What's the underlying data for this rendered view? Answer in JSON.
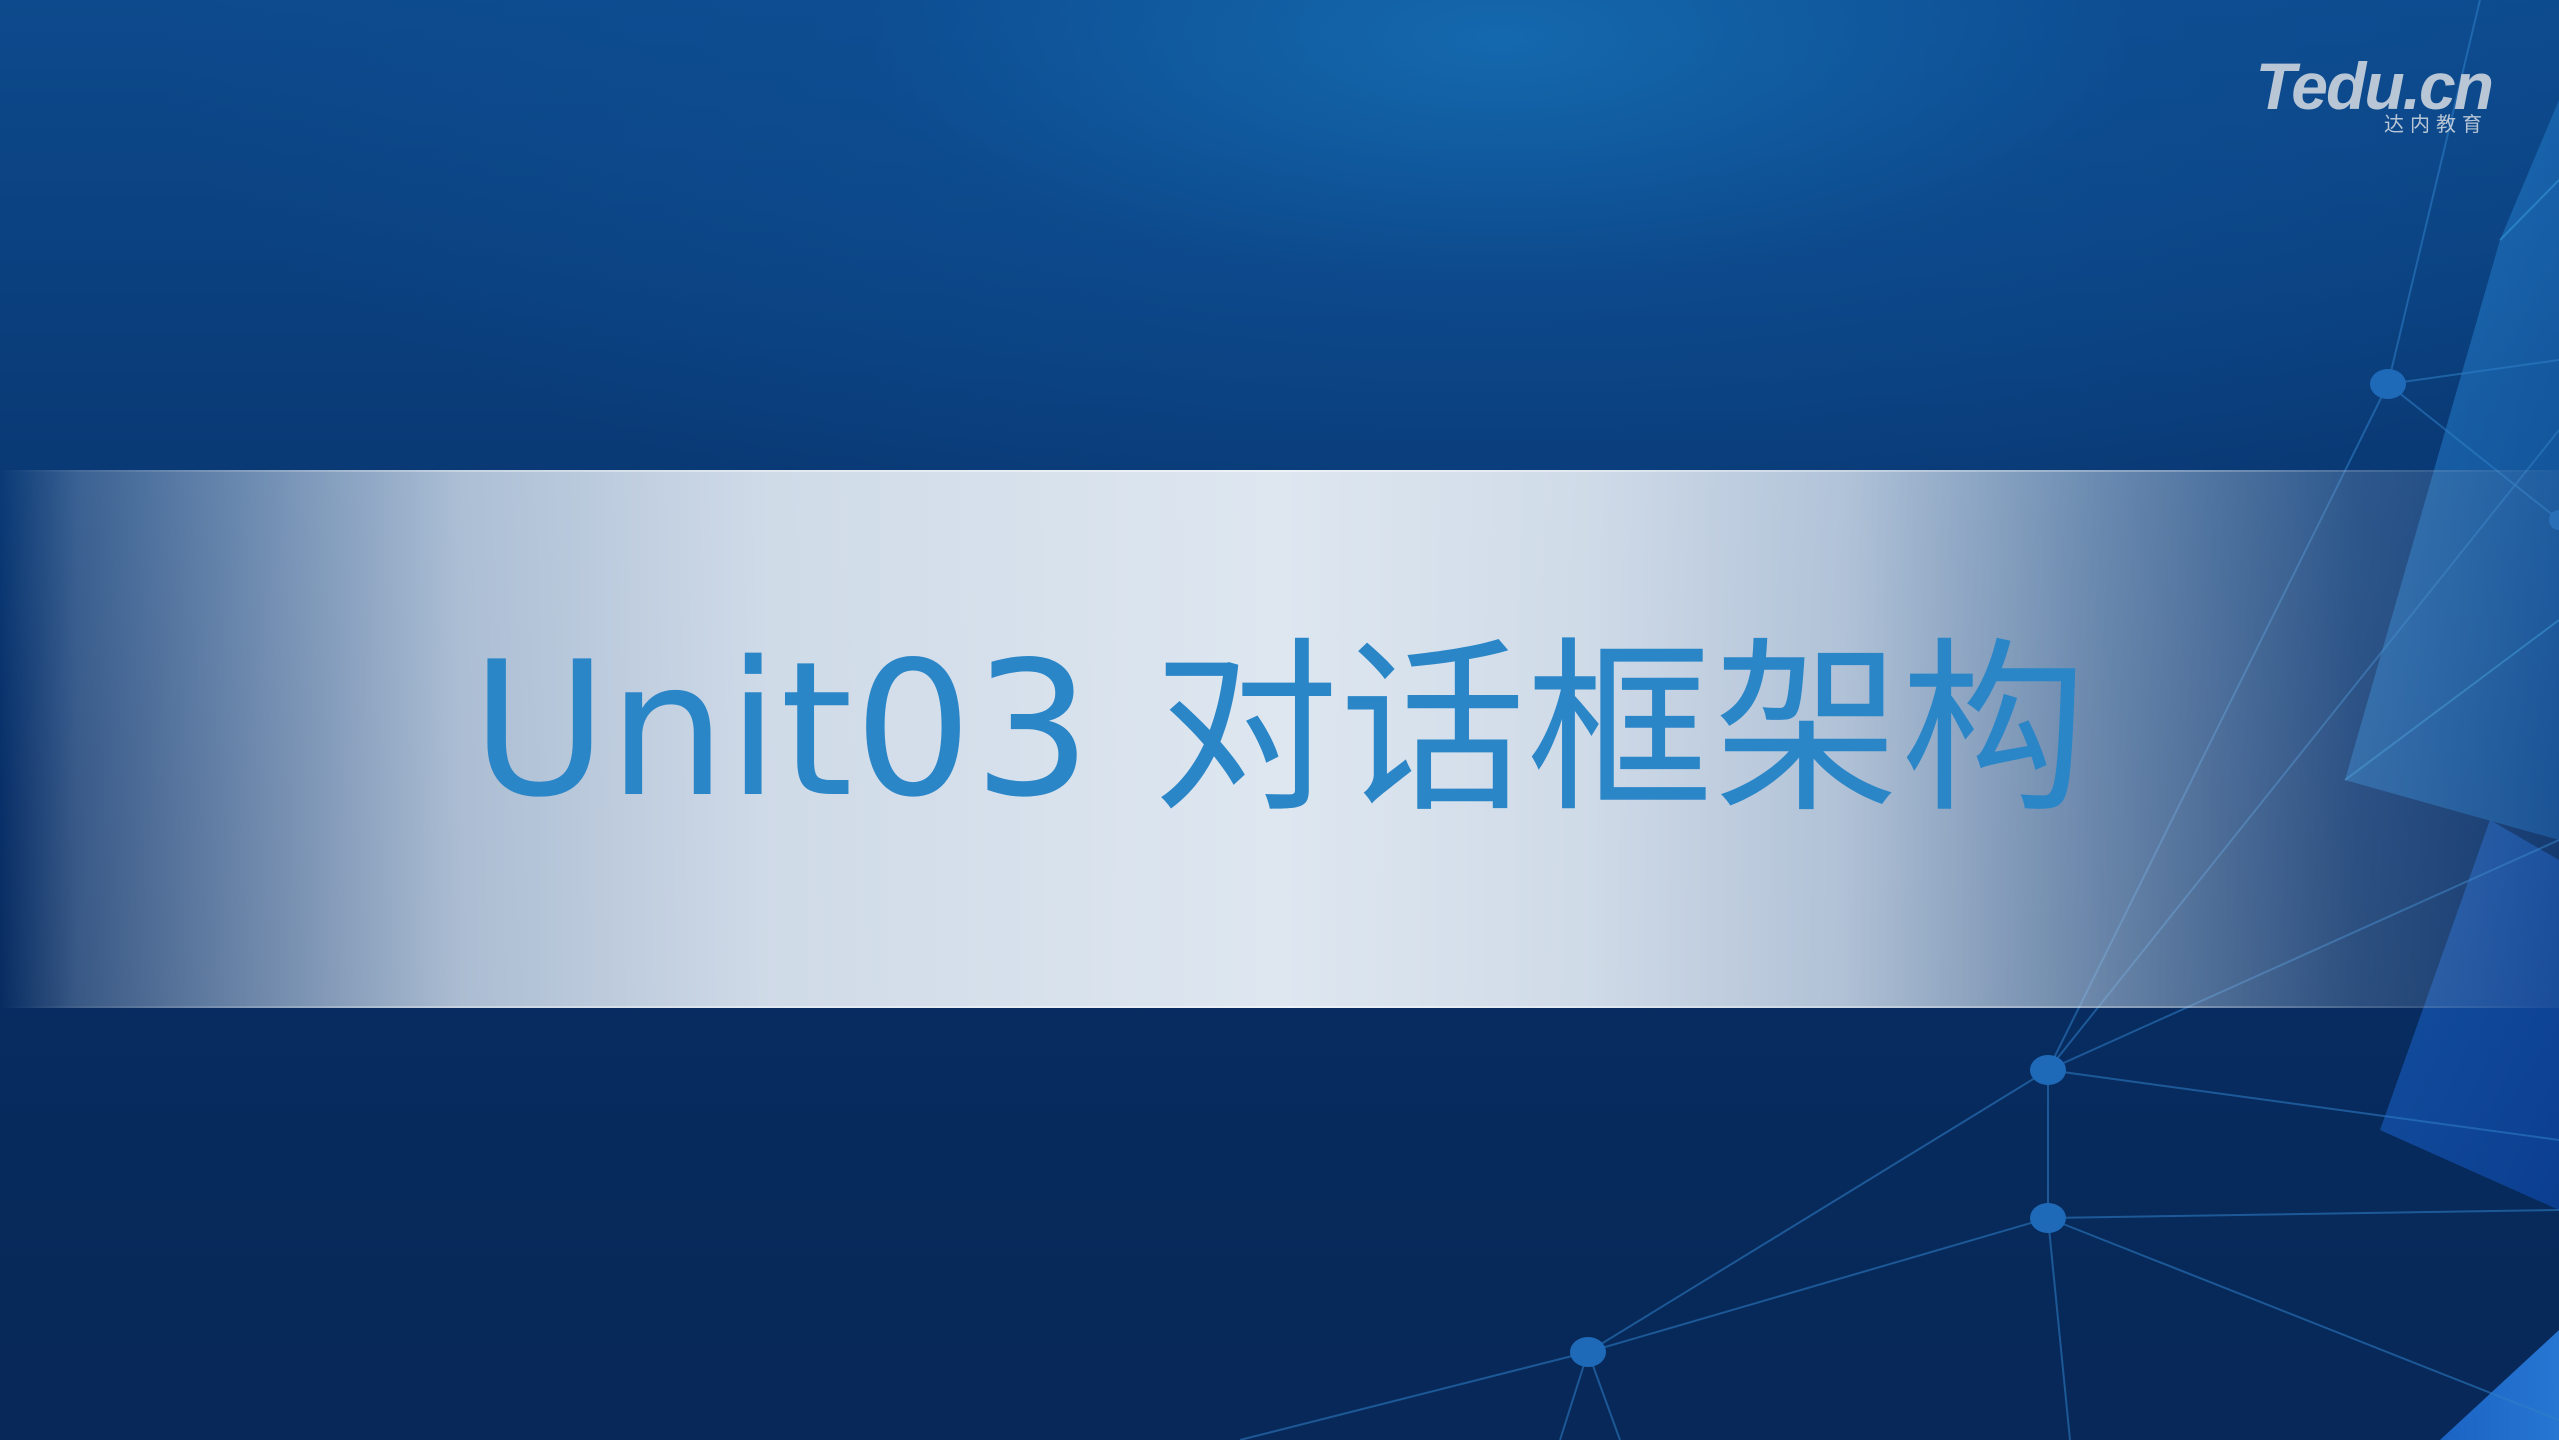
{
  "slide": {
    "title": "Unit03 对话框架构"
  },
  "logo": {
    "main_text": "Tedu.cn",
    "sub_text": "达内教育"
  },
  "colors": {
    "background": "#072b5c",
    "title": "#2b86c8",
    "band": "#dee7f0",
    "logo": "#b8c6d6"
  }
}
